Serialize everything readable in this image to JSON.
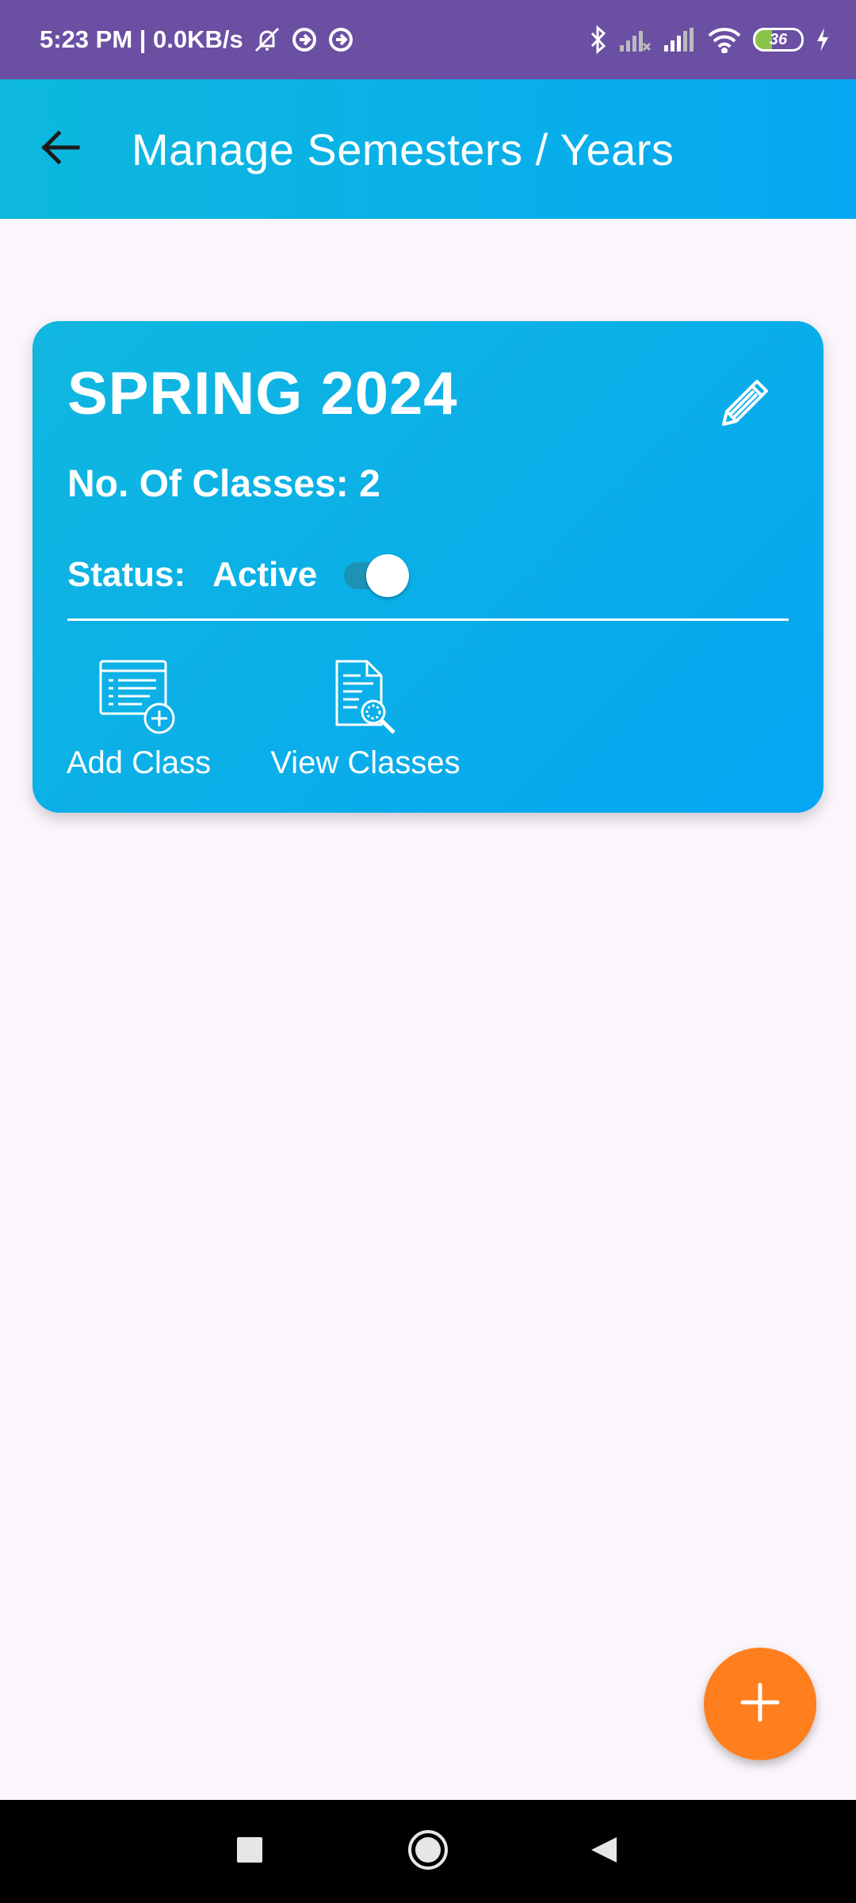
{
  "status_bar": {
    "time_speed": "5:23 PM | 0.0KB/s",
    "battery_level": "36",
    "icons": [
      "mute-icon",
      "sync-icon",
      "sync-icon",
      "bluetooth-icon",
      "signal-icon",
      "signal-icon",
      "wifi-icon",
      "battery-icon",
      "charging-icon"
    ]
  },
  "app_bar": {
    "title": "Manage Semesters / Years",
    "back_icon": "arrow-left-icon"
  },
  "semester_card": {
    "title": "SPRING 2024",
    "classes_label": "No. Of Classes: 2",
    "status_label": "Status:",
    "status_value": "Active",
    "status_on": true,
    "edit_icon": "pencil-icon",
    "actions": [
      {
        "label": "Add Class",
        "icon": "add-class-icon"
      },
      {
        "label": "View Classes",
        "icon": "view-classes-icon"
      }
    ]
  },
  "fab": {
    "icon": "plus-icon"
  },
  "colors": {
    "status_bar": "#6A4FA3",
    "app_bar_start": "#0DB8DC",
    "app_bar_end": "#06A9F2",
    "card": "#0AAEE9",
    "fab": "#FF7F1E",
    "background": "#FBF5FC"
  },
  "nav_bar": {
    "buttons": [
      "recents-icon",
      "home-icon",
      "back-icon"
    ]
  }
}
